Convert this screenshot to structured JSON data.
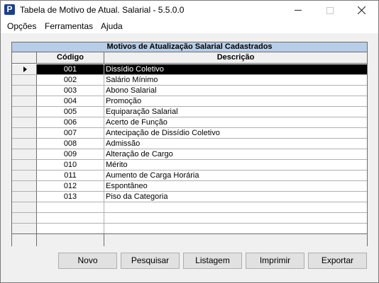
{
  "window": {
    "icon_letter": "P",
    "title": "Tabela de Motivo de Atual. Salarial - 5.5.0.0"
  },
  "menu": [
    {
      "label": "Opções"
    },
    {
      "label": "Ferramentas"
    },
    {
      "label": "Ajuda"
    }
  ],
  "grid": {
    "caption": "Motivos de Atualização Salarial Cadastrados",
    "columns": [
      "Código",
      "Descrição"
    ],
    "selected_row": 0,
    "rows": [
      {
        "codigo": "001",
        "descricao": "Dissídio Coletivo"
      },
      {
        "codigo": "002",
        "descricao": "Salário Mínimo"
      },
      {
        "codigo": "003",
        "descricao": "Abono Salarial"
      },
      {
        "codigo": "004",
        "descricao": "Promoção"
      },
      {
        "codigo": "005",
        "descricao": "Equiparação Salarial"
      },
      {
        "codigo": "006",
        "descricao": "Acerto de Função"
      },
      {
        "codigo": "007",
        "descricao": "Antecipação de Dissídio Coletivo"
      },
      {
        "codigo": "008",
        "descricao": "Admissão"
      },
      {
        "codigo": "009",
        "descricao": "Alteração de Cargo"
      },
      {
        "codigo": "010",
        "descricao": "Mérito"
      },
      {
        "codigo": "011",
        "descricao": "Aumento de Carga Horária"
      },
      {
        "codigo": "012",
        "descricao": "Espontâneo"
      },
      {
        "codigo": "013",
        "descricao": "Piso da Categoria"
      },
      {
        "codigo": "",
        "descricao": ""
      },
      {
        "codigo": "",
        "descricao": ""
      },
      {
        "codigo": "",
        "descricao": ""
      }
    ]
  },
  "buttons": {
    "novo": "Novo",
    "pesquisar": "Pesquisar",
    "listagem": "Listagem",
    "imprimir": "Imprimir",
    "exportar": "Exportar"
  },
  "colors": {
    "caption_bg": "#b7cde8",
    "selection_bg": "#000000",
    "app_icon_bg": "#1b3f8f"
  }
}
